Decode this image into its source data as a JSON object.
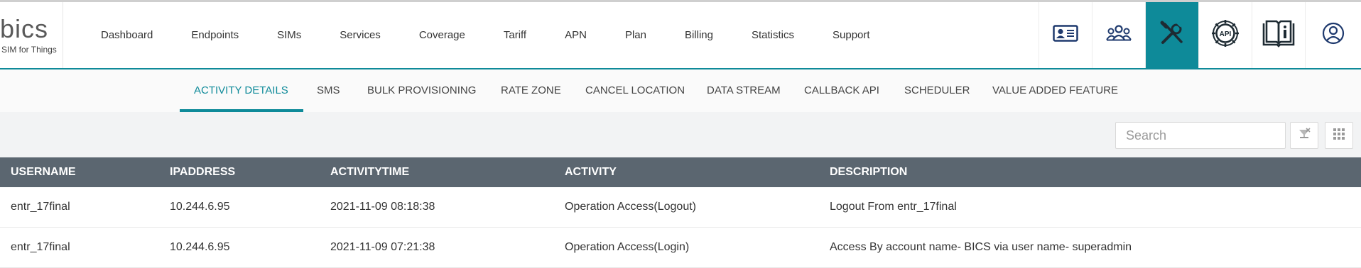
{
  "brand": {
    "name": "bics",
    "tagline": "SIM for Things"
  },
  "nav": {
    "items": [
      {
        "label": "Dashboard"
      },
      {
        "label": "Endpoints"
      },
      {
        "label": "SIMs"
      },
      {
        "label": "Services"
      },
      {
        "label": "Coverage"
      },
      {
        "label": "Tariff"
      },
      {
        "label": "APN"
      },
      {
        "label": "Plan"
      },
      {
        "label": "Billing"
      },
      {
        "label": "Statistics"
      },
      {
        "label": "Support"
      }
    ]
  },
  "header_icons": [
    {
      "name": "id-card-icon",
      "active": false
    },
    {
      "name": "users-group-icon",
      "active": false
    },
    {
      "name": "tools-icon",
      "active": true
    },
    {
      "name": "api-gear-icon",
      "active": false,
      "text": "API"
    },
    {
      "name": "book-info-icon",
      "active": false
    },
    {
      "name": "user-profile-icon",
      "active": false
    }
  ],
  "subnav": {
    "tabs": [
      {
        "label": "ACTIVITY DETAILS",
        "active": true
      },
      {
        "label": "SMS"
      },
      {
        "label": "BULK PROVISIONING"
      },
      {
        "label": "RATE ZONE"
      },
      {
        "label": "CANCEL LOCATION"
      },
      {
        "label": "DATA STREAM"
      },
      {
        "label": "CALLBACK API"
      },
      {
        "label": "SCHEDULER"
      },
      {
        "label": "VALUE ADDED FEATURE"
      }
    ]
  },
  "search": {
    "placeholder": "Search",
    "value": ""
  },
  "table": {
    "columns": [
      "USERNAME",
      "IPADDRESS",
      "ACTIVITYTIME",
      "ACTIVITY",
      "DESCRIPTION"
    ],
    "rows": [
      [
        "entr_17final",
        "10.244.6.95",
        "2021-11-09 08:18:38",
        "Operation Access(Logout)",
        "Logout From entr_17final"
      ],
      [
        "entr_17final",
        "10.244.6.95",
        "2021-11-09 07:21:38",
        "Operation Access(Login)",
        "Access By account name- BICS via user name- superadmin"
      ]
    ]
  },
  "colors": {
    "accent": "#0e8a99",
    "table_header": "#5b6670",
    "icon_navy": "#1f3a6e"
  }
}
